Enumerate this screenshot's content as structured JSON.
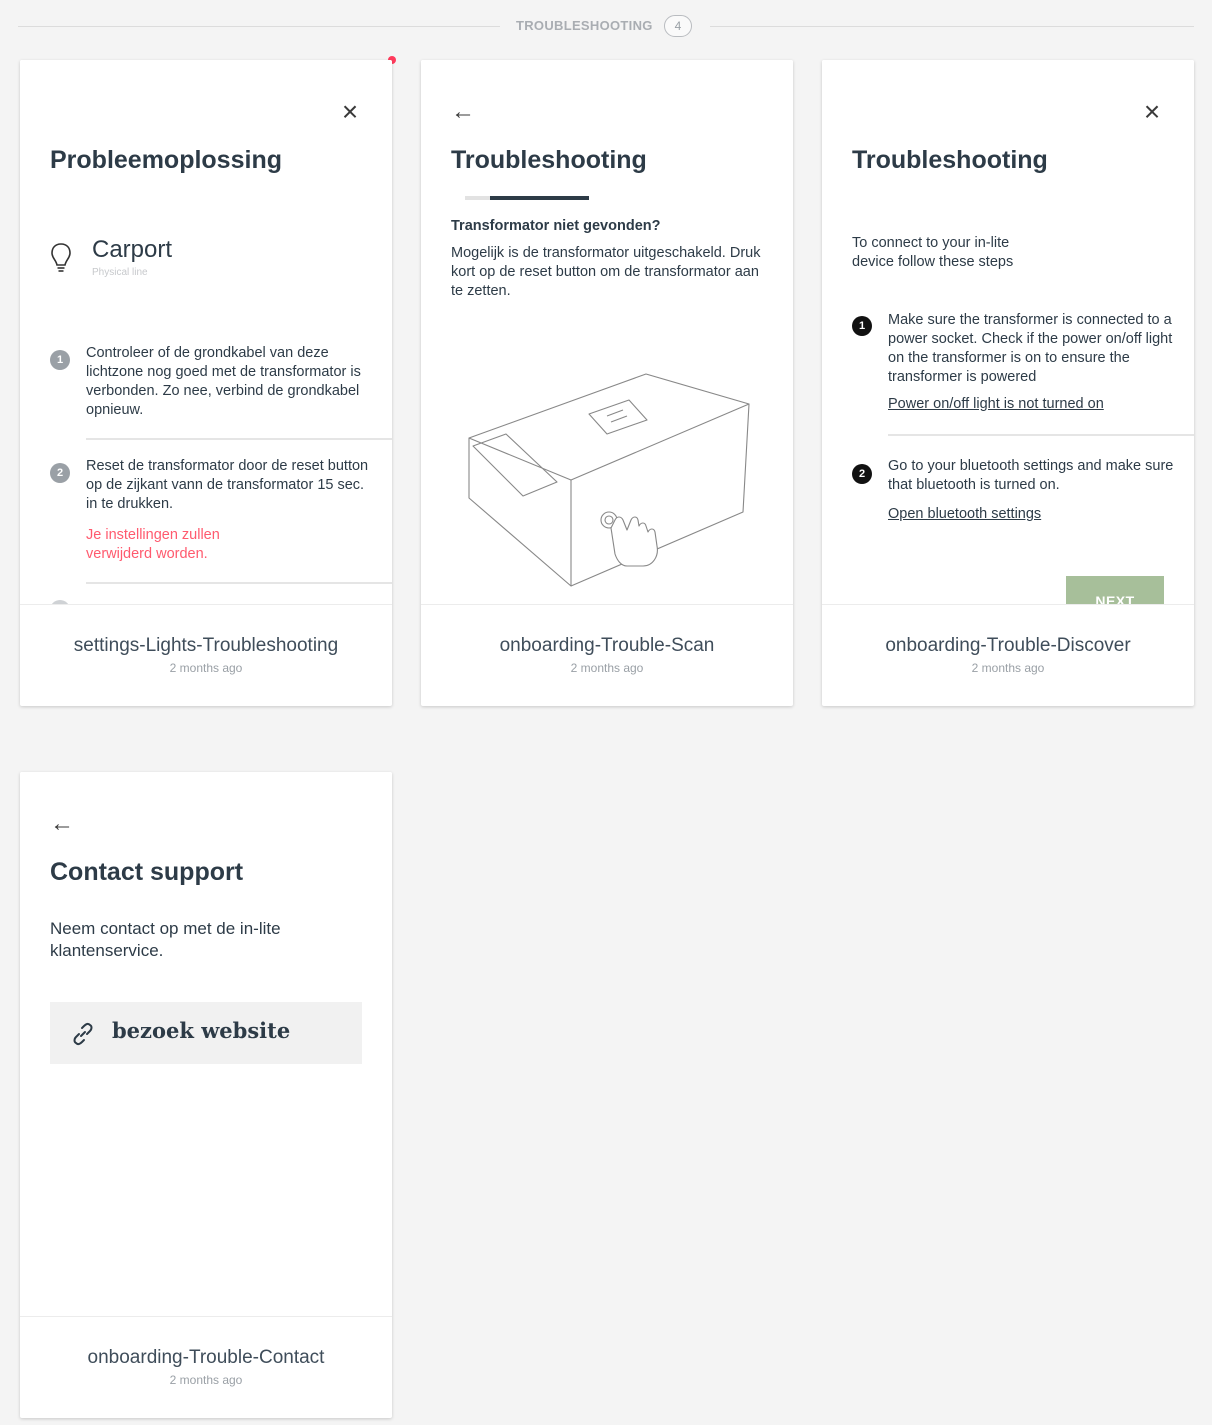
{
  "section": {
    "title": "TROUBLESHOOTING",
    "count": "4"
  },
  "cards": [
    {
      "name": "settings-Lights-Troubleshooting",
      "time": "2 months ago",
      "screen": {
        "title": "Probleemoplossing",
        "light_name": "Carport",
        "light_type": "Physical line",
        "steps": [
          {
            "num": "1",
            "text": "Controleer of de grondkabel van deze lichtzone nog goed met de transformator is verbonden. Zo nee, verbind de grondkabel opnieuw."
          },
          {
            "num": "2",
            "text": "Reset de transformator door de reset button op de zijkant vann de transformator 15 sec. in te drukken.",
            "warning": "Je instellingen zullen verwijderd worden."
          }
        ]
      }
    },
    {
      "name": "onboarding-Trouble-Scan",
      "time": "2 months ago",
      "screen": {
        "title": "Troubleshooting",
        "subtitle": "Transformator niet gevonden?",
        "text": "Mogelijk is de transformator uitgeschakeld. Druk kort op de reset button om de transformator aan te zetten.",
        "progress": 0.8
      }
    },
    {
      "name": "onboarding-Trouble-Discover",
      "time": "2 months ago",
      "screen": {
        "title": "Troubleshooting",
        "intro": "To connect to your in-lite device follow these steps",
        "steps": [
          {
            "num": "1",
            "text": "Make sure the transformer is connected to a power socket. Check if the power on/off light on the transformer is on to ensure the transformer is powered",
            "link": "Power on/off light is not turned on"
          },
          {
            "num": "2",
            "text": "Go to your bluetooth settings and make sure that bluetooth is turned on.",
            "link": "Open bluetooth settings"
          }
        ],
        "next_label": "NEXT"
      }
    },
    {
      "name": "onboarding-Trouble-Contact",
      "time": "2 months ago",
      "screen": {
        "title": "Contact support",
        "text": "Neem contact op met de in-lite klantenservice.",
        "button_label": "bezoek website"
      }
    }
  ],
  "colors": {
    "accent_green": "#a7bf9a",
    "warning_red": "#ff5a6e",
    "progress_dark": "#2d3b47"
  }
}
